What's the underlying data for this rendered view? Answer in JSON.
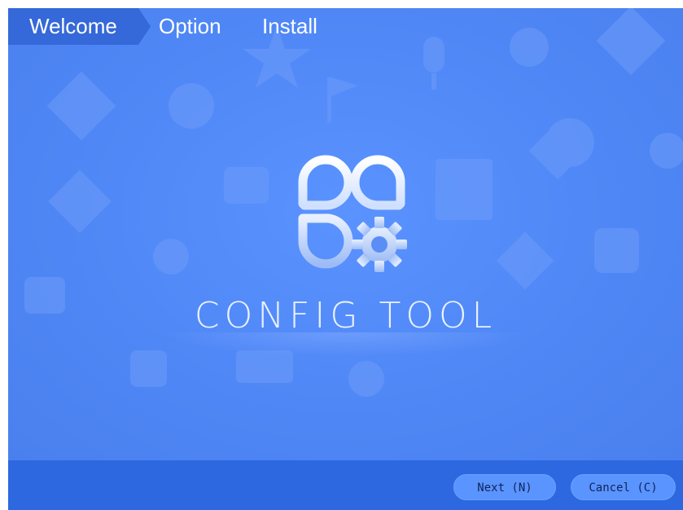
{
  "steps": {
    "items": [
      {
        "label": "Welcome",
        "active": true
      },
      {
        "label": "Option",
        "active": false
      },
      {
        "label": "Install",
        "active": false
      }
    ]
  },
  "main": {
    "title": "CONFIG TOOL",
    "logo_icon": "config-tool-logo-icon"
  },
  "footer": {
    "next_label": "Next (N)",
    "cancel_label": "Cancel (C)"
  },
  "colors": {
    "background": "#4f87f6",
    "footer": "#2d68e1",
    "active_step": "#3568d8",
    "button": "#5a94ff"
  }
}
